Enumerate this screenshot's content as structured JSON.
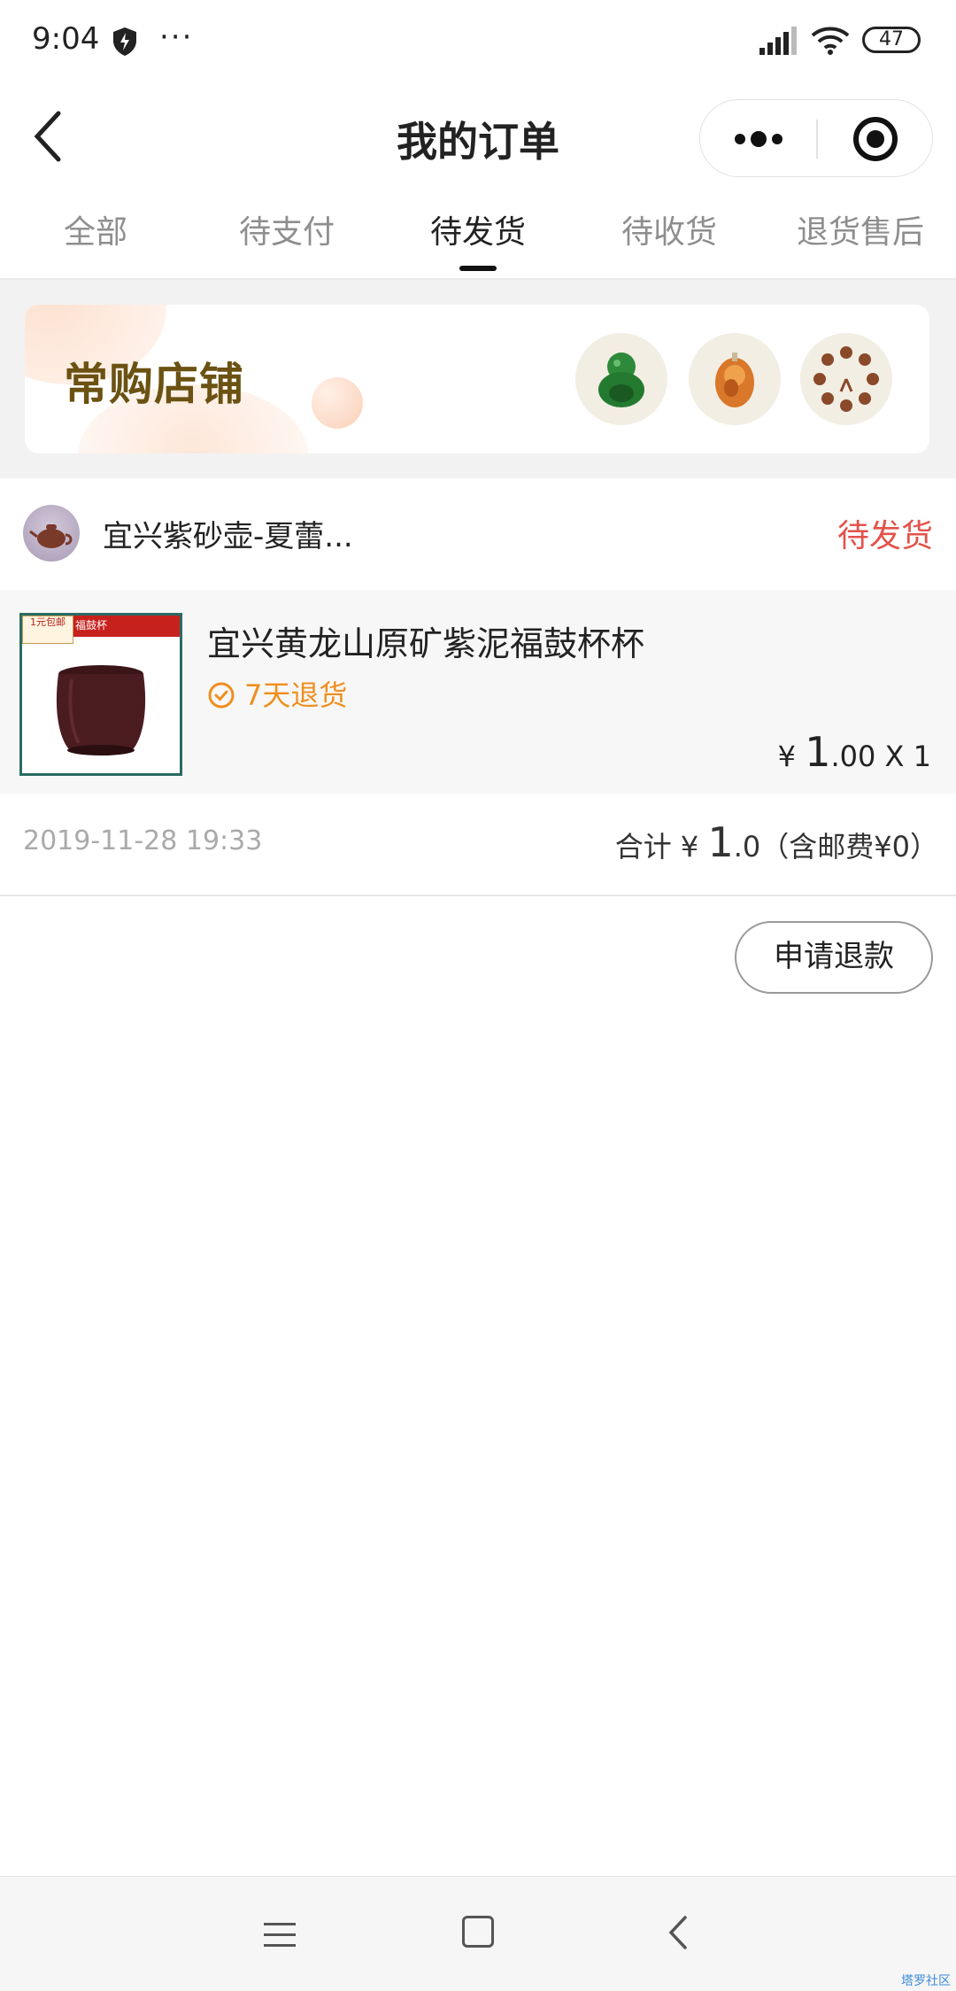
{
  "status_bar": {
    "time": "9:04",
    "extra_dots": "···",
    "battery": "47",
    "icons": [
      "shield-icon",
      "signal-icon",
      "wifi-icon",
      "battery-icon"
    ]
  },
  "nav": {
    "title": "我的订单",
    "back_icon": "chevron-left-icon",
    "capsule_icons": [
      "more-dots-icon",
      "close-target-icon"
    ]
  },
  "tabs": [
    {
      "label": "全部",
      "active": false
    },
    {
      "label": "待支付",
      "active": false
    },
    {
      "label": "待发货",
      "active": true
    },
    {
      "label": "待收货",
      "active": false
    },
    {
      "label": "退货售后",
      "active": false
    }
  ],
  "banner": {
    "title": "常购店铺",
    "thumbnails": [
      "jade-buddha-thumb",
      "amber-pendant-thumb",
      "bead-bracelet-thumb"
    ]
  },
  "order": {
    "shop_name": "宜兴紫砂壶-夏蕾...",
    "status": "待发货",
    "product": {
      "title": "宜兴黄龙山原矿紫泥福鼓杯杯",
      "return_policy": "7天退货",
      "currency": "¥",
      "price_int": "1",
      "price_dec": ".00",
      "quantity": "X 1",
      "image_badge": "1元包邮",
      "image_tag": "福鼓杯"
    },
    "date": "2019-11-28 19:33",
    "total_label": "合计",
    "currency": "¥",
    "total_int": "1",
    "total_dec": ".0",
    "shipping_note": "（含邮费¥0）"
  },
  "actions": {
    "refund_label": "申请退款"
  },
  "system_nav": {
    "icons": [
      "menu-icon",
      "home-icon",
      "back-icon"
    ]
  },
  "watermark": "塔罗社区"
}
